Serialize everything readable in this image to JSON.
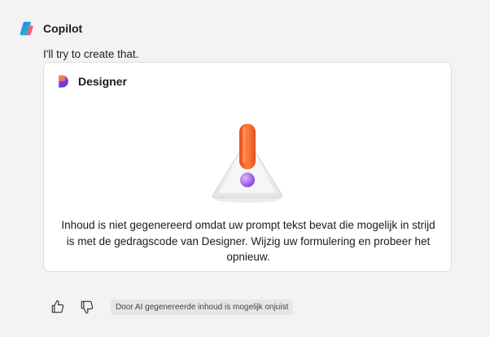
{
  "header": {
    "assistant_name": "Copilot",
    "logo_icon": "copilot-logo-icon"
  },
  "conversation": {
    "intro_text": "I'll try to create that."
  },
  "designer_card": {
    "title": "Designer",
    "logo_icon": "designer-logo-icon",
    "illustration_icon": "warning-exclamation-illustration",
    "message": "Inhoud is niet gegenereerd omdat uw prompt tekst bevat die mogelijk in strijd is met de gedragscode van Designer. Wijzig uw formulering en probeer het opnieuw."
  },
  "feedback": {
    "thumbs_up_icon": "thumbs-up-icon",
    "thumbs_down_icon": "thumbs-down-icon",
    "disclaimer": "Door AI gegenereerde inhoud is mogelijk onjuist"
  },
  "colors": {
    "background": "#f3f3f3",
    "card_background": "#ffffff",
    "card_border": "#dedede",
    "exclamation_orange": "#f26a2e",
    "dot_purple": "#9b5de5"
  }
}
